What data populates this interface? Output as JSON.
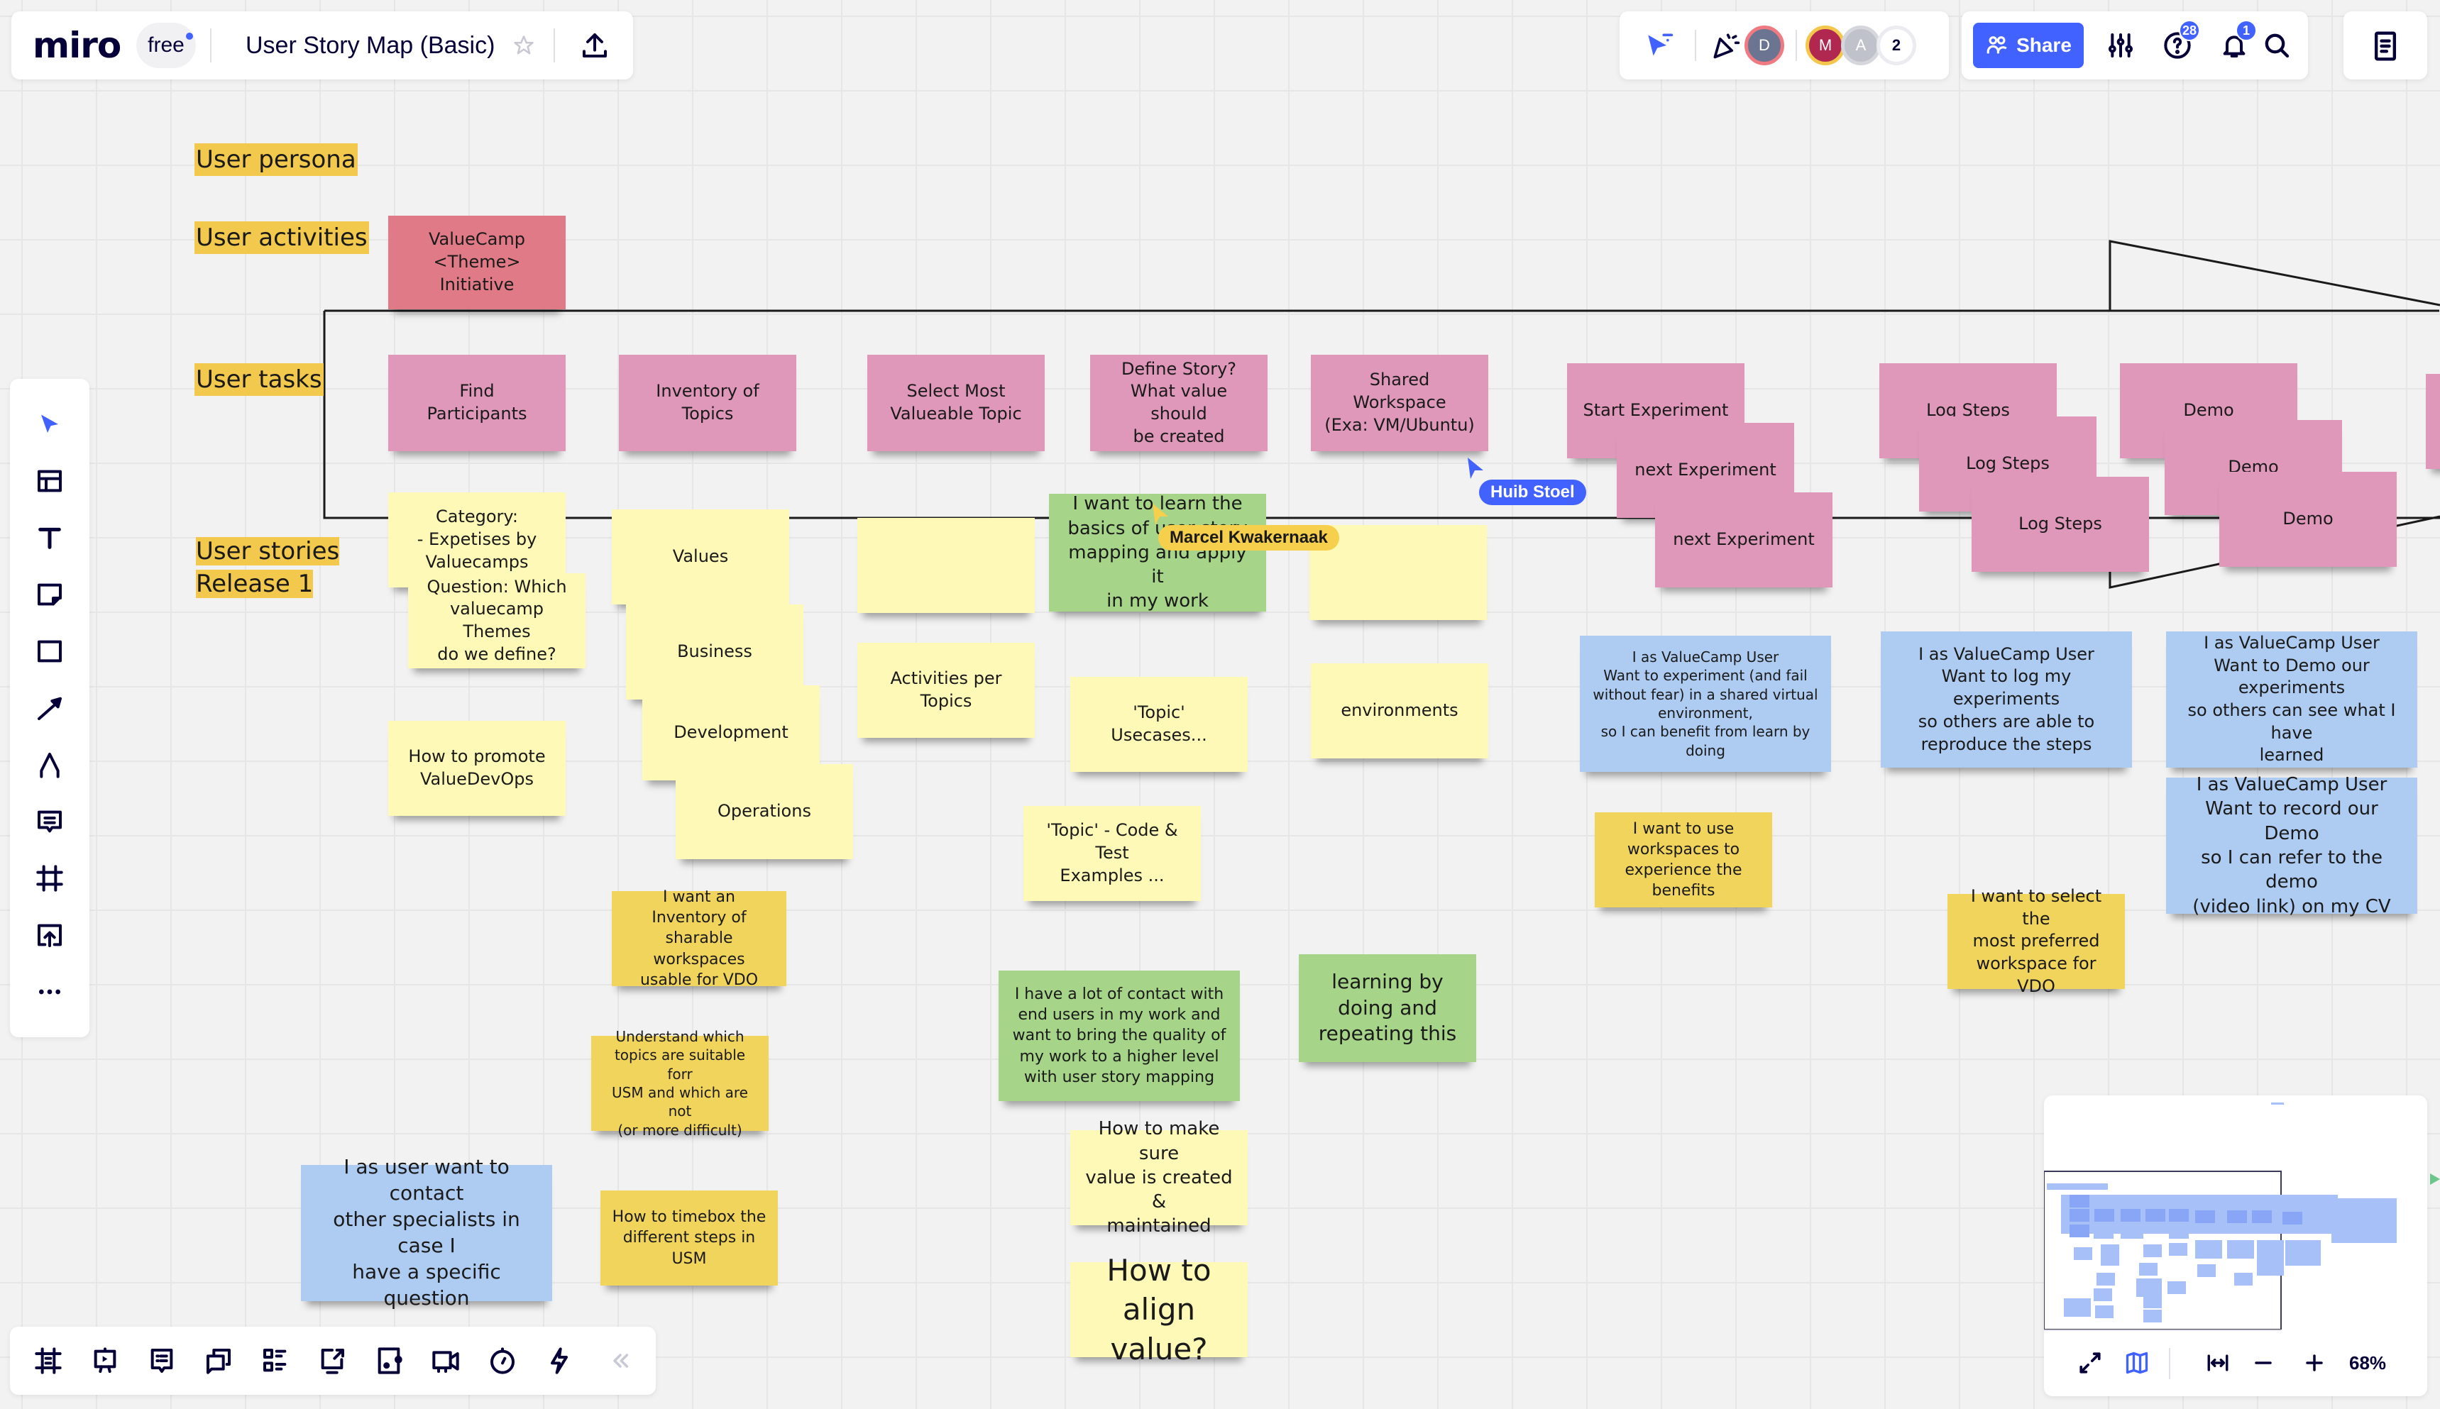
{
  "header": {
    "logo": "miro",
    "plan_badge": "free",
    "board_title": "User Story Map (Basic)"
  },
  "collab": {
    "avatars": [
      {
        "initial": "D",
        "color": "#6b7591",
        "ring": "#ef7a82"
      },
      {
        "initial": "M",
        "color": "#b0284f",
        "ring": "#f3c64c"
      },
      {
        "initial": "A",
        "color": "#bfc2cb",
        "ring": "#d6d7dd"
      }
    ],
    "extra_count": "2",
    "share_label": "Share",
    "help_badge": "28",
    "notifications_badge": "1"
  },
  "row_labels": {
    "persona": "User persona",
    "activities": "User activities",
    "tasks": "User tasks",
    "stories": "User stories\nRelease 1"
  },
  "activity": {
    "text": "ValueCamp\n<Theme>\nInitiative"
  },
  "tasks": [
    {
      "text": "Find\nParticipants"
    },
    {
      "text": "Inventory of Topics"
    },
    {
      "text": "Select Most\nValueable Topic"
    },
    {
      "text": "Define Story?\nWhat value should\nbe created"
    },
    {
      "text": "Shared Workspace\n(Exa: VM/Ubuntu)"
    },
    {
      "text": "Start Experiment"
    },
    {
      "text": "next Experiment"
    },
    {
      "text": "next Experiment"
    },
    {
      "text": "Log Steps"
    },
    {
      "text": "Log Steps"
    },
    {
      "text": "Log Steps"
    },
    {
      "text": "Demo"
    },
    {
      "text": "Demo"
    },
    {
      "text": "Demo"
    }
  ],
  "stories": {
    "category": "Category:\n- Expetises by\nValuecamps",
    "question": "Question: Which\nvaluecamp Themes\ndo we define?",
    "promote": "How to promote\nValueDevOps",
    "values": "Values",
    "business": "Business",
    "development": "Development",
    "operations": "Operations",
    "empty1": "",
    "activities_per_topics": "Activities per Topics",
    "learn_basics": "I want to learn the\nbasics of user story\nmapping and apply it\nin my work",
    "topic_usecases": "'Topic'\nUsecases...",
    "topic_code": "'Topic' - Code & Test\nExamples ...",
    "empty2": "",
    "environments": "environments",
    "inventory_workspaces": "I want an Inventory of\nsharable workspaces\nusable for VDO",
    "understand_topics": "Understand which\ntopics are suitable forr\nUSM and which are not\n(or more difficult)",
    "timebox": "How to timebox the\ndifferent steps in\nUSM",
    "contact_specialists": "I as user want to contact\nother specialists in case I\nhave a specific question",
    "contact_end_users": "I have a lot of contact with\nend users in my work and\nwant to bring the quality of\nmy work to a higher level\nwith user story mapping",
    "learning_by_doing": "learning by\ndoing and\nrepeating this",
    "value_created": "How to make sure\nvalue is created &\nmaintained",
    "align_value": "How to\nalign value?",
    "experiment_user": "I as ValueCamp User\nWant to experiment (and fail\nwithout fear) in a shared virtual\nenvironment,\nso I can benefit from learn by doing",
    "use_workspaces": "I want to use\nworkspaces to\nexperience the\nbenefits",
    "log_user": "I as ValueCamp User\nWant to log my experiments\nso others are able to\nreproduce the steps",
    "select_workspace": "I want to select the\nmost preferred\nworkspace for VDO",
    "demo_user": "I as ValueCamp User\nWant to Demo our\nexperiments\nso others can see what I have\nlearned",
    "record_demo": "I as ValueCamp User\nWant to record our Demo\nso  I can refer to the demo\n(video link) on my CV"
  },
  "cursors": [
    {
      "name": "Marcel Kwakernaak",
      "color": "#f6cf4c"
    },
    {
      "name": "Huib Stoel",
      "color": "#4262ff"
    }
  ],
  "left_tools": [
    "select-tool",
    "templates-tool",
    "text-tool",
    "sticky-note-tool",
    "shape-tool",
    "connection-line-tool",
    "pen-tool",
    "comment-tool",
    "frame-tool",
    "upload-tool",
    "more-tools"
  ],
  "bottom_tools": [
    "frames-panel",
    "presentation",
    "comments",
    "chat",
    "card-list",
    "screen-share",
    "sticky-capture",
    "video-chat",
    "timer",
    "activity-lightning"
  ],
  "zoom": {
    "level": "68%"
  },
  "colors": {
    "accent": "#4262ff",
    "sticky_pink": "#df98b9",
    "sticky_red": "#e07a86",
    "sticky_yellow_light": "#fef9b7",
    "sticky_yellow": "#f1d45c",
    "sticky_green": "#a6d488",
    "sticky_blue": "#aecbf2",
    "label_bg": "#f2c94c"
  }
}
